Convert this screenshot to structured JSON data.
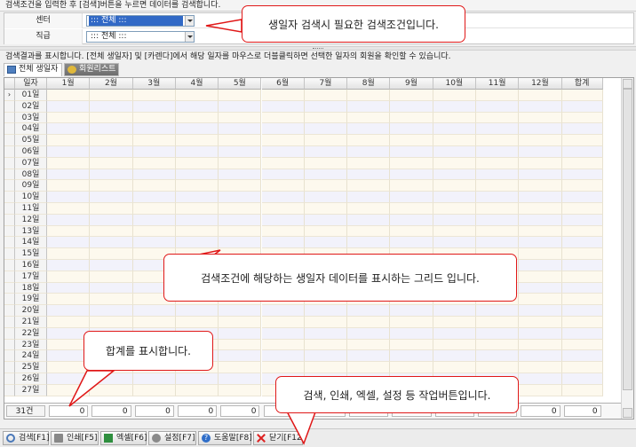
{
  "search_hint": "검색조건을 입력한 후 [검색]버튼을 누르면 데이터를 검색합니다.",
  "filters": [
    {
      "label": "센터",
      "value": "::: 전체 :::"
    },
    {
      "label": "직급",
      "value": "::: 전체 :::"
    }
  ],
  "result_hint": "검색결과를 표시합니다. [전체 생일자] 및 [카렌다]에서 해당 일자를 마우스로 더블클릭하면 선택한 일자의 회원을 확인할 수 있습니다.",
  "tabs": [
    {
      "label": "전체 생일자",
      "icon": "grid-icon"
    },
    {
      "label": "회원리스트",
      "icon": "members-icon"
    }
  ],
  "grid": {
    "columns": [
      "일자",
      "1월",
      "2월",
      "3월",
      "4월",
      "5월",
      "6월",
      "7월",
      "8월",
      "9월",
      "10월",
      "11월",
      "12월",
      "합계"
    ],
    "row_indicator": "›",
    "days": [
      "01일",
      "02일",
      "03일",
      "04일",
      "05일",
      "06일",
      "07일",
      "08일",
      "09일",
      "10일",
      "11일",
      "12일",
      "13일",
      "14일",
      "15일",
      "16일",
      "17일",
      "18일",
      "19일",
      "20일",
      "21일",
      "22일",
      "23일",
      "24일",
      "25일",
      "26일",
      "27일"
    ],
    "footer": {
      "count": "31건",
      "totals": [
        "0",
        "0",
        "0",
        "0",
        "0",
        "0",
        "0",
        "0",
        "0",
        "0",
        "0",
        "0",
        "0"
      ]
    }
  },
  "toolbar": [
    {
      "label": "검색[F1]",
      "icon": "search-icon"
    },
    {
      "label": "인쇄[F5]",
      "icon": "print-icon"
    },
    {
      "label": "엑셀[F6]",
      "icon": "excel-icon"
    },
    {
      "label": "설정[F7]",
      "icon": "gear-icon"
    },
    {
      "label": "도움말[F8]",
      "icon": "help-icon"
    },
    {
      "label": "닫기[F12]",
      "icon": "close-icon"
    }
  ],
  "callouts": {
    "filters": "생일자 검색시 필요한 검색조건입니다.",
    "grid": "검색조건에 해당하는 생일자 데이터를 표시하는 그리드 입니다.",
    "totals": "합계를 표시합니다.",
    "toolbar": "검색, 인쇄, 엑셀, 설정 등 작업버튼입니다."
  }
}
